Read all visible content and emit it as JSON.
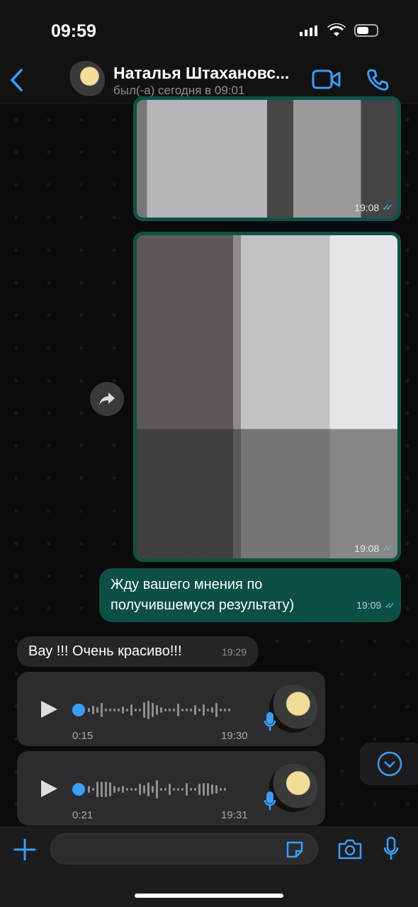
{
  "status": {
    "time": "09:59"
  },
  "header": {
    "name": "Наталья Штахановс...",
    "last_seen": "был(-а) сегодня в 09:01",
    "accent": "#3a9ef5"
  },
  "messages": [
    {
      "type": "image",
      "time": "19:08",
      "status": "read"
    },
    {
      "type": "image",
      "time": "19:08",
      "status": "read"
    },
    {
      "type": "text",
      "direction": "out",
      "lines": [
        "Жду вашего мнения по",
        "получившемуся результату)"
      ],
      "time": "19:09",
      "status": "read"
    },
    {
      "type": "text",
      "direction": "in",
      "text": "Вау !!! Очень красиво!!!",
      "time": "19:29"
    },
    {
      "type": "voice",
      "direction": "in",
      "duration": "0:15",
      "time": "19:30",
      "progress": 0
    },
    {
      "type": "voice",
      "direction": "in",
      "duration": "0:21",
      "time": "19:31",
      "progress": 0
    }
  ],
  "ticks": "✓✓"
}
